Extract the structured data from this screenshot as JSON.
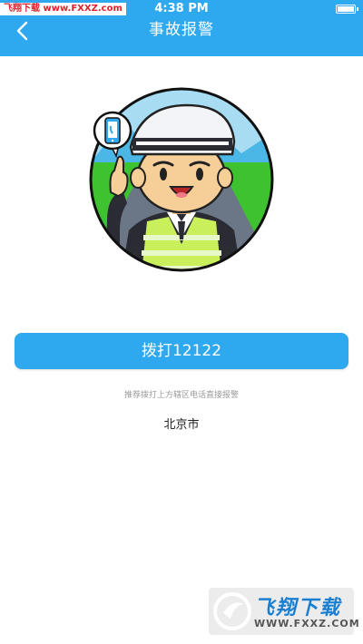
{
  "status_bar": {
    "watermark": "飞翔下载 www.FXXZ.com",
    "time": "4:38 PM"
  },
  "header": {
    "title": "事故报警",
    "back_icon": "chevron-left-icon"
  },
  "main": {
    "illustration": "traffic-police-avatar",
    "call_button_label": "拨打12122",
    "hint": "推荐拨打上方辖区电话直接报警",
    "city": "北京市"
  },
  "watermark": {
    "title": "飞翔下载",
    "url": "WWW.FXXZ.COM"
  },
  "colors": {
    "accent": "#2ea8ef"
  }
}
